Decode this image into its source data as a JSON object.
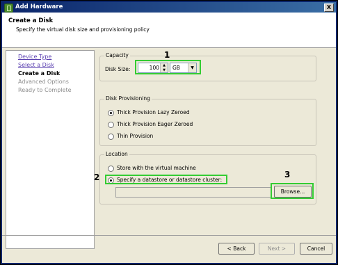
{
  "window": {
    "title": "Add Hardware",
    "close_glyph": "X"
  },
  "header": {
    "title": "Create a Disk",
    "subtitle": "Specify the virtual disk size and provisioning policy"
  },
  "nav": {
    "items": [
      {
        "label": "Device Type"
      },
      {
        "label": "Select a Disk"
      },
      {
        "label": "Create a Disk"
      },
      {
        "label": "Advanced Options"
      },
      {
        "label": "Ready to Complete"
      }
    ]
  },
  "capacity": {
    "title": "Capacity",
    "disk_size_label": "Disk Size:",
    "size_value": "100",
    "unit": "GB"
  },
  "provisioning": {
    "title": "Disk Provisioning",
    "options": [
      {
        "label": "Thick Provision Lazy Zeroed",
        "checked": true
      },
      {
        "label": "Thick Provision Eager Zeroed",
        "checked": false
      },
      {
        "label": "Thin Provision",
        "checked": false
      }
    ]
  },
  "location": {
    "title": "Location",
    "options": [
      {
        "label": "Store with the virtual machine",
        "checked": false
      },
      {
        "label": "Specify a datastore or datastore cluster:",
        "checked": true
      }
    ],
    "path_value": "",
    "browse_label": "Browse..."
  },
  "annotations": {
    "n1": "1",
    "n2": "2",
    "n3": "3",
    "color": "#33cc33"
  },
  "footer": {
    "back_label": "< Back",
    "next_label": "Next >",
    "cancel_label": "Cancel"
  }
}
